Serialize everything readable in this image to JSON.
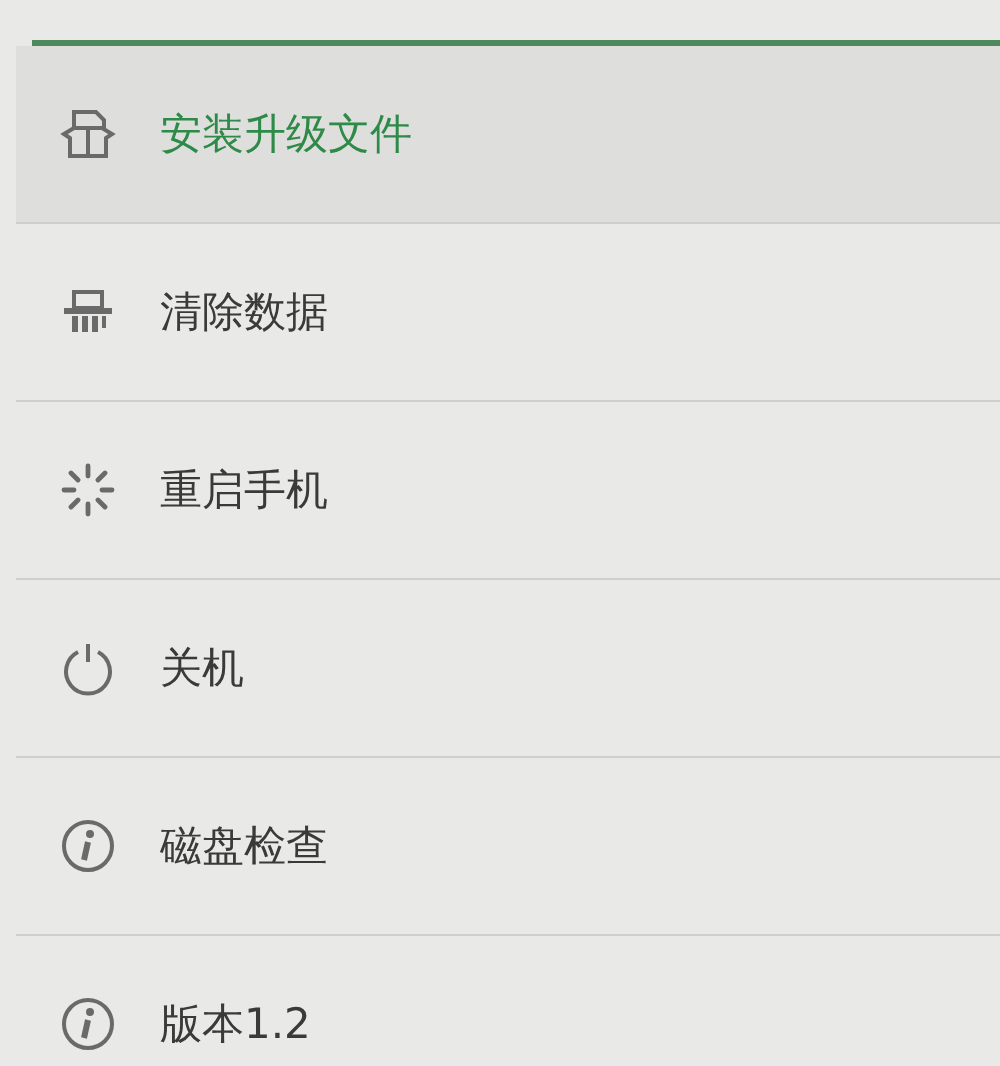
{
  "menu": {
    "items": [
      {
        "label": "安装升级文件",
        "kind": "package",
        "selected": true
      },
      {
        "label": "清除数据",
        "kind": "shredder",
        "selected": false
      },
      {
        "label": "重启手机",
        "kind": "spinner",
        "selected": false
      },
      {
        "label": "关机",
        "kind": "power",
        "selected": false
      },
      {
        "label": "磁盘检查",
        "kind": "info",
        "selected": false
      },
      {
        "label": "版本1.2",
        "kind": "info",
        "selected": false
      }
    ]
  }
}
